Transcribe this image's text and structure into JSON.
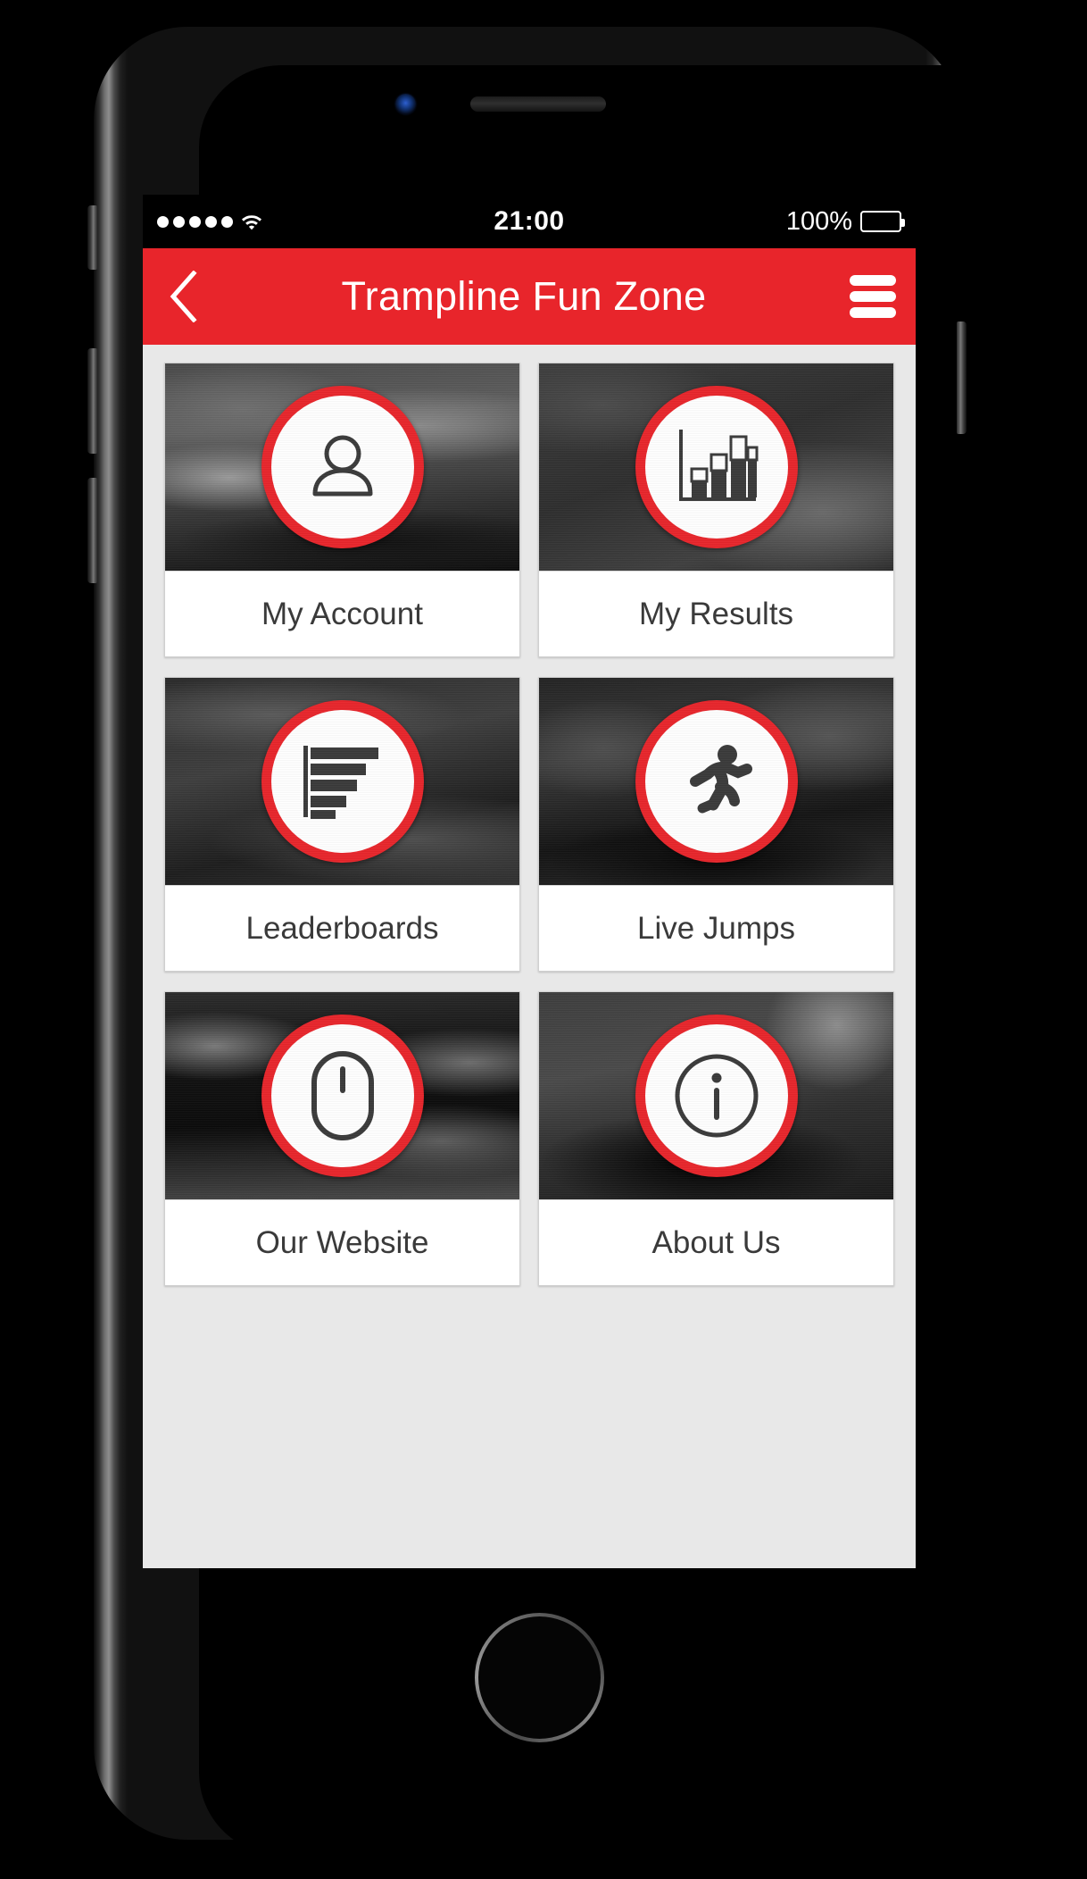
{
  "device": {
    "name": "smartphone-mockup",
    "hardware": {
      "earpiece": "earpiece-speaker",
      "camera": "front-camera",
      "home_button": "home-button",
      "mute_switch": "mute-switch",
      "volume_up": "volume-up-button",
      "volume_down": "volume-down-button",
      "power": "power-button"
    }
  },
  "status_bar": {
    "signal_dots": 5,
    "signal_icon": "signal-dots-icon",
    "wifi_icon": "wifi-icon",
    "time": "21:00",
    "battery_percent": "100%",
    "battery_icon": "battery-full-icon"
  },
  "header": {
    "back_icon": "back-chevron-icon",
    "title": "Trampline Fun Zone",
    "menu_icon": "hamburger-menu-icon",
    "background_color": "#E8252B",
    "text_color": "#FFFFFF"
  },
  "theme": {
    "accent": "#E8252B",
    "screen_background": "#E8E8E8",
    "tile_background": "#FFFFFF",
    "label_text": "#3A3A3A"
  },
  "grid": {
    "columns": 2,
    "tiles": [
      {
        "label": "My Account",
        "icon": "person-icon"
      },
      {
        "label": "My Results",
        "icon": "bar-chart-icon"
      },
      {
        "label": "Leaderboards",
        "icon": "horizontal-bar-chart-icon"
      },
      {
        "label": "Live Jumps",
        "icon": "running-person-icon"
      },
      {
        "label": "Our Website",
        "icon": "computer-mouse-icon"
      },
      {
        "label": "About Us",
        "icon": "info-circle-icon"
      }
    ]
  }
}
